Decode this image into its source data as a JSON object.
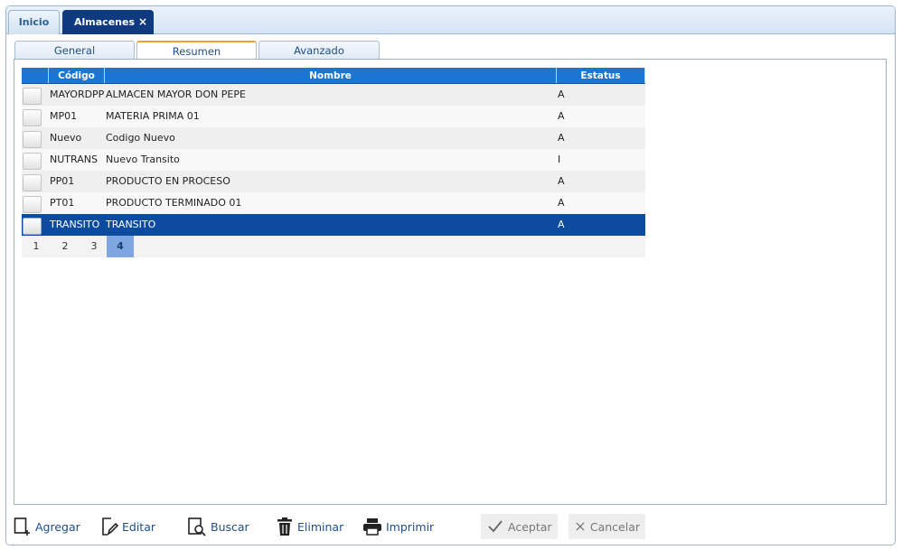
{
  "tabs": {
    "inicio": "Inicio",
    "almacenes": "Almacenes",
    "close_glyph": "×"
  },
  "subtabs": [
    "General",
    "Resumen",
    "Avanzado"
  ],
  "grid": {
    "columns": {
      "codigo": "Código",
      "nombre": "Nombre",
      "estatus": "Estatus"
    },
    "rows": [
      {
        "codigo": "MAYORDPP",
        "nombre": "ALMACEN MAYOR DON PEPE",
        "estatus": "A"
      },
      {
        "codigo": "MP01",
        "nombre": "MATERIA PRIMA 01",
        "estatus": "A"
      },
      {
        "codigo": "Nuevo",
        "nombre": "Codigo Nuevo",
        "estatus": "A"
      },
      {
        "codigo": "NUTRANS",
        "nombre": "Nuevo Transito",
        "estatus": "I"
      },
      {
        "codigo": "PP01",
        "nombre": "PRODUCTO EN PROCESO",
        "estatus": "A"
      },
      {
        "codigo": "PT01",
        "nombre": "PRODUCTO TERMINADO 01",
        "estatus": "A"
      },
      {
        "codigo": "TRANSITO",
        "nombre": "TRANSITO",
        "estatus": "A"
      }
    ],
    "pages": [
      "1",
      "2",
      "3",
      "4"
    ],
    "current_page": "4"
  },
  "toolbar": {
    "agregar": "Agregar",
    "editar": "Editar",
    "buscar": "Buscar",
    "eliminar": "Eliminar",
    "imprimir": "Imprimir",
    "aceptar": "Aceptar",
    "cancelar": "Cancelar"
  },
  "icons": {
    "agregar": "add-document-icon",
    "editar": "edit-pencil-icon",
    "buscar": "search-document-icon",
    "eliminar": "trash-icon",
    "imprimir": "printer-icon",
    "aceptar": "checkmark-icon",
    "cancelar": "close-icon"
  },
  "colors": {
    "header_blue": "#1a76d2",
    "selected_row": "#0d4b9e",
    "active_tab": "#0f3a80",
    "subtab_accent": "#f0a030",
    "current_page": "#7ea6e0"
  }
}
